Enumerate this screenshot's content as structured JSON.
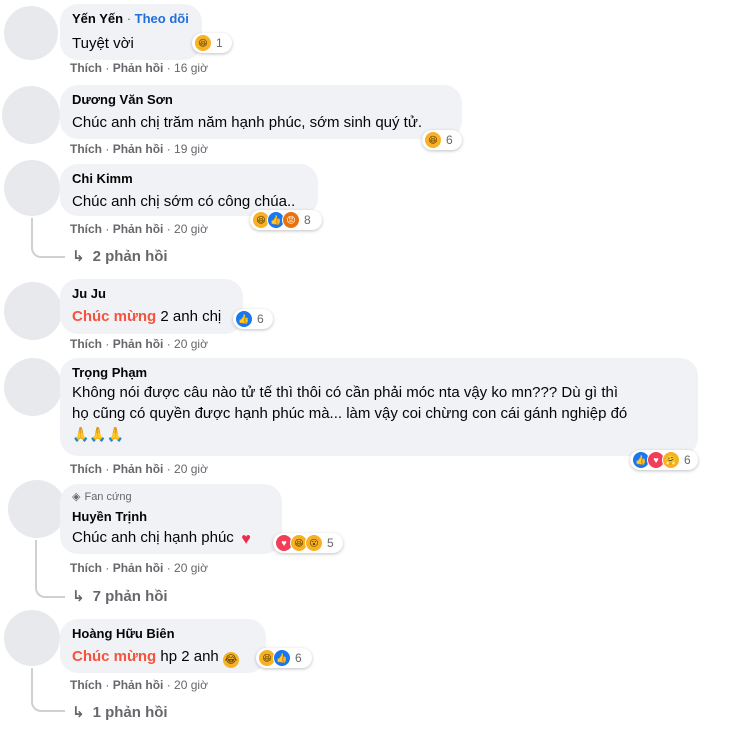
{
  "actions": {
    "like": "Thích",
    "reply": "Phản hồi",
    "sep": "·"
  },
  "comments": [
    {
      "author": "Yến Yến",
      "follow": "Theo dõi",
      "text": "Tuyệt vời",
      "time": "16 giờ",
      "reactions": [
        "haha-icon"
      ],
      "reaction_count": "1"
    },
    {
      "author": "Dương Văn Sơn",
      "text": "Chúc anh chị trăm năm hạnh phúc, sớm sinh quý tử.",
      "time": "19 giờ",
      "reactions": [
        "haha-icon"
      ],
      "reaction_count": "6"
    },
    {
      "author": "Chi Kimm",
      "text": "Chúc anh chị sớm có công chúa..",
      "time": "20 giờ",
      "reactions": [
        "haha-icon",
        "like-icon",
        "angry-icon"
      ],
      "reaction_count": "8",
      "replies": "2 phản hồi"
    },
    {
      "author": "Ju Ju",
      "highlight": "Chúc mừng",
      "text": "2 anh chị",
      "time": "20 giờ",
      "reactions": [
        "like-icon"
      ],
      "reaction_count": "6"
    },
    {
      "author": "Trọng Phạm",
      "text_lines": [
        "Không nói được câu nào tử tế thì thôi có cần phải móc nta vậy ko mn??? Dù gì thì",
        "họ cũng có quyền được hạnh phúc mà... làm vậy coi chừng con cái gánh nghiệp đó",
        "🙏🙏🙏"
      ],
      "time": "20 giờ",
      "reactions": [
        "like-icon",
        "love-icon",
        "care-icon"
      ],
      "reaction_count": "6"
    },
    {
      "badge": "Fan cứng",
      "author": "Huyền Trịnh",
      "text": "Chúc anh chị hạnh phúc",
      "time": "20 giờ",
      "reactions": [
        "love-icon",
        "haha-icon",
        "wow-icon"
      ],
      "reaction_count": "5",
      "replies": "7 phản hồi"
    },
    {
      "author": "Hoàng Hữu Biên",
      "highlight": "Chúc mừng",
      "text": "hp 2 anh",
      "time": "20 giờ",
      "reactions": [
        "haha-icon",
        "like-icon"
      ],
      "reaction_count": "6",
      "replies": "1 phản hồi"
    }
  ],
  "colors": {
    "bubble": "#f0f2f5",
    "secondary_text": "#65676b",
    "highlight": "#f5533d",
    "follow": "#216fdb",
    "like": "#1877f2",
    "love": "#f33e58",
    "haha": "#f7b125",
    "angry": "#e9710f"
  }
}
